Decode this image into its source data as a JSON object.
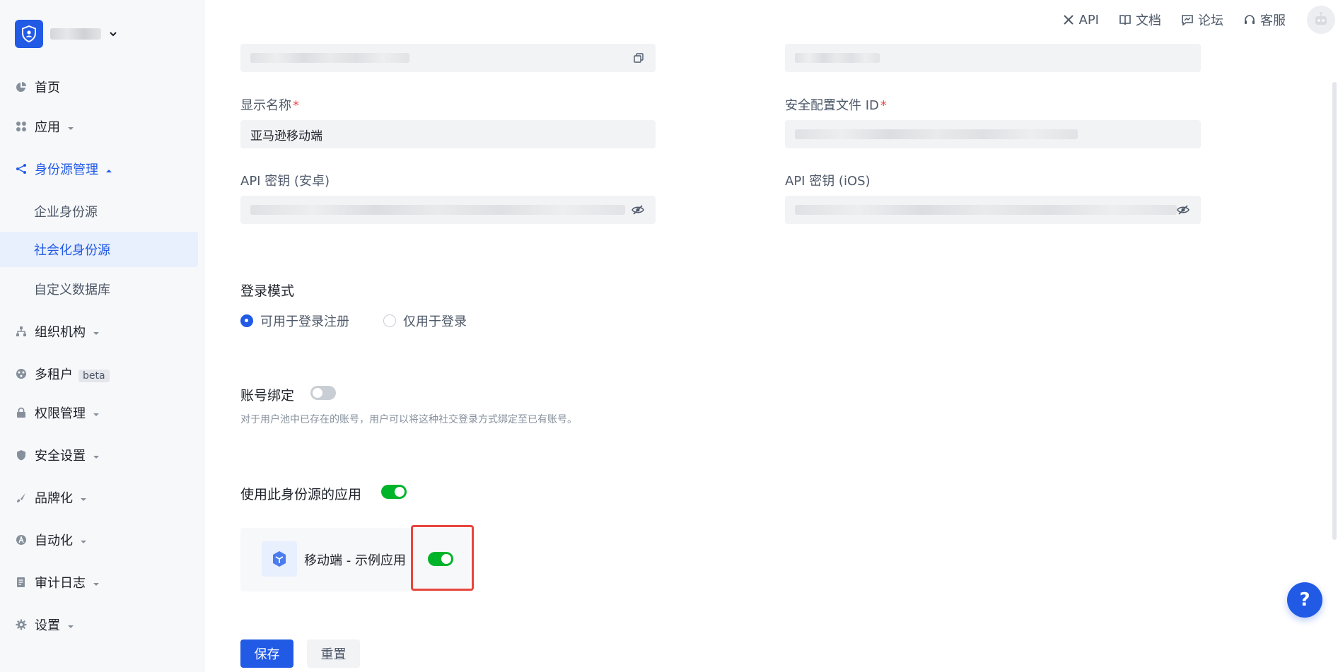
{
  "topbar": {
    "links": [
      {
        "label": "API",
        "icon": "tools-icon"
      },
      {
        "label": "文档",
        "icon": "book-icon"
      },
      {
        "label": "论坛",
        "icon": "chat-icon"
      },
      {
        "label": "客服",
        "icon": "headset-icon"
      }
    ]
  },
  "sidebar": {
    "items": [
      {
        "label": "首页",
        "icon": "pie-chart-icon"
      },
      {
        "label": "应用",
        "icon": "apps-icon"
      },
      {
        "label": "身份源管理",
        "icon": "share-icon"
      },
      {
        "label": "组织机构",
        "icon": "org-icon"
      },
      {
        "label": "多租户",
        "icon": "tenant-icon",
        "badge": "beta"
      },
      {
        "label": "权限管理",
        "icon": "lock-icon"
      },
      {
        "label": "安全设置",
        "icon": "shield-icon"
      },
      {
        "label": "品牌化",
        "icon": "brush-icon"
      },
      {
        "label": "自动化",
        "icon": "automation-icon"
      },
      {
        "label": "审计日志",
        "icon": "log-icon"
      },
      {
        "label": "设置",
        "icon": "gear-icon"
      }
    ],
    "sub_items": [
      {
        "label": "企业身份源"
      },
      {
        "label": "社会化身份源",
        "selected": true
      },
      {
        "label": "自定义数据库"
      }
    ]
  },
  "form": {
    "display_name_label": "显示名称",
    "display_name_value": "亚马逊移动端",
    "security_profile_label": "安全配置文件 ID",
    "api_key_android_label": "API 密钥 (安卓)",
    "api_key_ios_label": "API 密钥 (iOS)",
    "required_mark": "*",
    "login_mode_label": "登录模式",
    "login_mode_options": [
      "可用于登录注册",
      "仅用于登录"
    ],
    "login_mode_selected": "可用于登录注册",
    "account_binding_label": "账号绑定",
    "account_binding_enabled": false,
    "account_binding_hint": "对于用户池中已存在的账号，用户可以将这种社交登录方式绑定至已有账号。",
    "apps_label": "使用此身份源的应用",
    "apps_all_enabled": true,
    "apps": [
      {
        "name": "移动端 - 示例应用",
        "enabled": true
      }
    ]
  },
  "actions": {
    "save_label": "保存",
    "reset_label": "重置"
  },
  "help": {
    "label": "?"
  },
  "colors": {
    "accent": "#215ae5",
    "toggle_on": "#00b42a",
    "required": "#f53f3f",
    "highlight": "#e8453c"
  }
}
